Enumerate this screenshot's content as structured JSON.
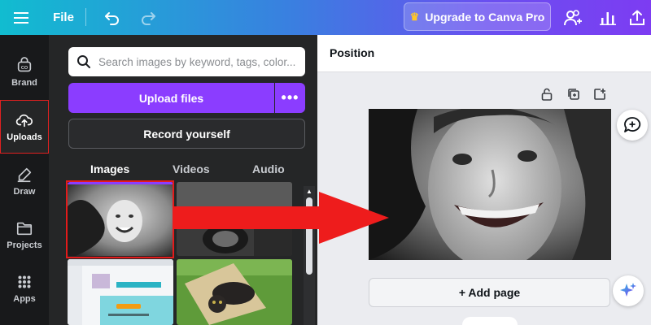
{
  "topbar": {
    "file_label": "File",
    "upgrade_label": "Upgrade to Canva Pro",
    "icons": [
      "menu-icon",
      "undo-icon",
      "redo-icon",
      "crown-icon",
      "share-people-icon",
      "analytics-icon",
      "share-upload-icon"
    ]
  },
  "rail": {
    "items": [
      {
        "label": "Brand",
        "icon": "brand-icon",
        "active": false
      },
      {
        "label": "Uploads",
        "icon": "cloud-upload-icon",
        "active": true
      },
      {
        "label": "Draw",
        "icon": "pen-icon",
        "active": false
      },
      {
        "label": "Projects",
        "icon": "folder-icon",
        "active": false
      },
      {
        "label": "Apps",
        "icon": "apps-grid-icon",
        "active": false
      }
    ]
  },
  "panel": {
    "search_placeholder": "Search images by keyword, tags, color...",
    "upload_label": "Upload files",
    "more_label": "•••",
    "record_label": "Record yourself",
    "tabs": [
      {
        "label": "Images",
        "active": true
      },
      {
        "label": "Videos",
        "active": false
      },
      {
        "label": "Audio",
        "active": false
      }
    ],
    "thumbnails": [
      "smiling-child-photo",
      "black-white-texture-photo",
      "website-screenshot",
      "cat-on-grass-photo"
    ]
  },
  "canvas": {
    "header_label": "Position",
    "add_page_label": "+ Add page",
    "photo": "smiling-child-photo"
  },
  "colors": {
    "accent_purple": "#8b3dff",
    "annotation_red": "#e31b1b",
    "panel_dark": "#252627",
    "rail_dark": "#18191b"
  }
}
